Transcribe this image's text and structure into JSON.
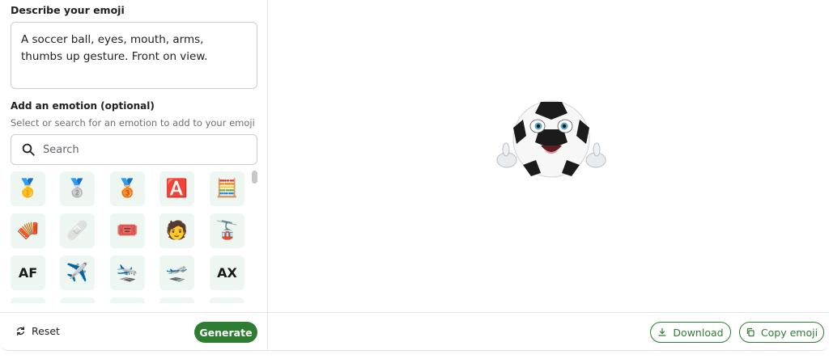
{
  "describe": {
    "label": "Describe your emoji",
    "value": "A soccer ball, eyes, mouth, arms, thumbs up gesture. Front on view."
  },
  "emotion": {
    "label": "Add an emotion (optional)",
    "hint": "Select or search for an emotion to add to your emoji",
    "search_placeholder": "Search"
  },
  "emoji_grid": [
    "🥇",
    "🥈",
    "🥉",
    "🅰️",
    "🧮",
    "🪗",
    "🩹",
    "🎟️",
    "🧑",
    "🚡",
    "AF",
    "✈️",
    "🛬",
    "🛫",
    "AX"
  ],
  "actions": {
    "reset_label": "Reset",
    "generate_label": "Generate",
    "download_label": "Download",
    "copy_label": "Copy emoji"
  },
  "colors": {
    "accent": "#2e7d32",
    "tile_bg": "#eef6f1"
  }
}
